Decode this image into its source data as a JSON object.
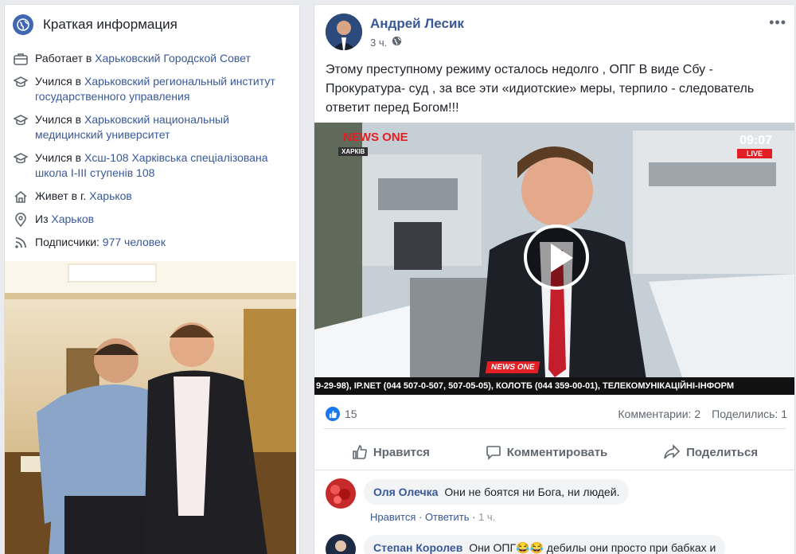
{
  "intro": {
    "title": "Краткая информация",
    "items": [
      {
        "icon": "briefcase-icon",
        "prefix": "Работает в ",
        "link": "Харьковский Городской Совет"
      },
      {
        "icon": "graduation-cap-icon",
        "prefix": "Учился в ",
        "link": "Харьковский региональный институт государственного управления"
      },
      {
        "icon": "graduation-cap-icon",
        "prefix": "Учился в ",
        "link": "Харьковский национальный медицинский университет"
      },
      {
        "icon": "graduation-cap-icon",
        "prefix": "Учился в ",
        "link": "Хсш-108 Харківська спеціалізована школа I-III ступенів 108"
      },
      {
        "icon": "home-icon",
        "prefix": "Живет в г. ",
        "link": "Харьков"
      },
      {
        "icon": "location-pin-icon",
        "prefix": "Из ",
        "link": "Харьков"
      },
      {
        "icon": "rss-icon",
        "prefix": "Подписчики: ",
        "link": "977 человек"
      }
    ]
  },
  "post": {
    "author": "Андрей Лесик",
    "time": "3 ч.",
    "privacy_icon": "globe-icon",
    "text": "Этому преступному режиму осталось недолго , ОПГ В виде Сбу - Прокуратура- суд , за все эти «идиотские» меры, терпило - следователь ответит перед Богом!!!",
    "video": {
      "channel_logo": "ONE",
      "channel_prefix": "NEWS",
      "city": "ХАРКІВ",
      "clock": "09:07",
      "live": "LIVE",
      "badge": "NEWS ONE",
      "ticker": "9-29-98), IP.NET (044 507-0-507, 507-05-05), КОЛОТБ (044 359-00-01), ТЕЛЕКОМУНІКАЦІЙНІ-ІНФОРМ"
    },
    "likes": "15",
    "comments_count": "Комментарии: 2",
    "shares_count": "Поделились: 1",
    "actions": {
      "like": "Нравится",
      "comment": "Комментировать",
      "share": "Поделиться"
    }
  },
  "comments": [
    {
      "name": "Оля Олечка",
      "text": "Они не боятся ни Бога, ни людей.",
      "like": "Нравится",
      "reply": "Ответить",
      "time": "1 ч."
    },
    {
      "name": "Степан Королев",
      "text": "Они ОПГ😂😂 дебилы они просто при бабках и"
    }
  ],
  "colors": {
    "link": "#385898",
    "accent": "#4267b2",
    "like_blue": "#1877f2",
    "live_red": "#e31e24"
  }
}
